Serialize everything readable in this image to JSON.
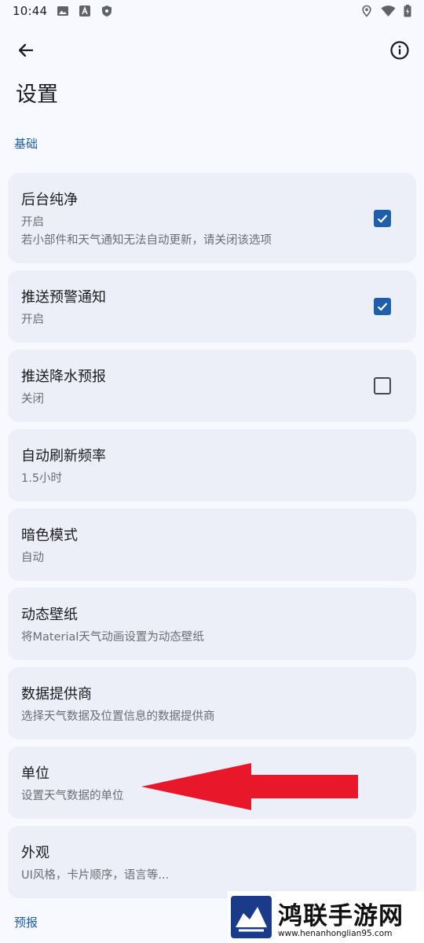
{
  "status_bar": {
    "time": "10:44",
    "left_icons": [
      "image-icon",
      "font-a-icon",
      "shield-icon"
    ],
    "right_icons": [
      "location-icon",
      "wifi-icon",
      "battery-icon"
    ]
  },
  "toolbar": {
    "back_icon": "arrow-left-icon",
    "info_icon": "info-circle-icon"
  },
  "page": {
    "title": "设置"
  },
  "sections": [
    {
      "title": "基础"
    },
    {
      "title": "预报"
    }
  ],
  "items": [
    {
      "title": "后台纯净",
      "subtitle": "开启",
      "subtitle2": "若小部件和天气通知无法自动更新，请关闭该选项",
      "checked": true
    },
    {
      "title": "推送预警通知",
      "subtitle": "开启",
      "checked": true
    },
    {
      "title": "推送降水预报",
      "subtitle": "关闭",
      "checked": false
    },
    {
      "title": "自动刷新频率",
      "subtitle": "1.5小时"
    },
    {
      "title": "暗色模式",
      "subtitle": "自动"
    },
    {
      "title": "动态壁纸",
      "subtitle": "将Material天气动画设置为动态壁纸"
    },
    {
      "title": "数据提供商",
      "subtitle": "选择天气数据及位置信息的数据提供商"
    },
    {
      "title": "单位",
      "subtitle": "设置天气数据的单位"
    },
    {
      "title": "外观",
      "subtitle": "UI风格，卡片顺序，语言等..."
    }
  ],
  "colors": {
    "accent": "#1f5ea8",
    "card": "#eceff8",
    "background": "#f8f9ff",
    "annotation_arrow": "#e8182a"
  },
  "watermark": {
    "name": "鸿联手游网",
    "url": "www.henanhonglian95.com"
  }
}
